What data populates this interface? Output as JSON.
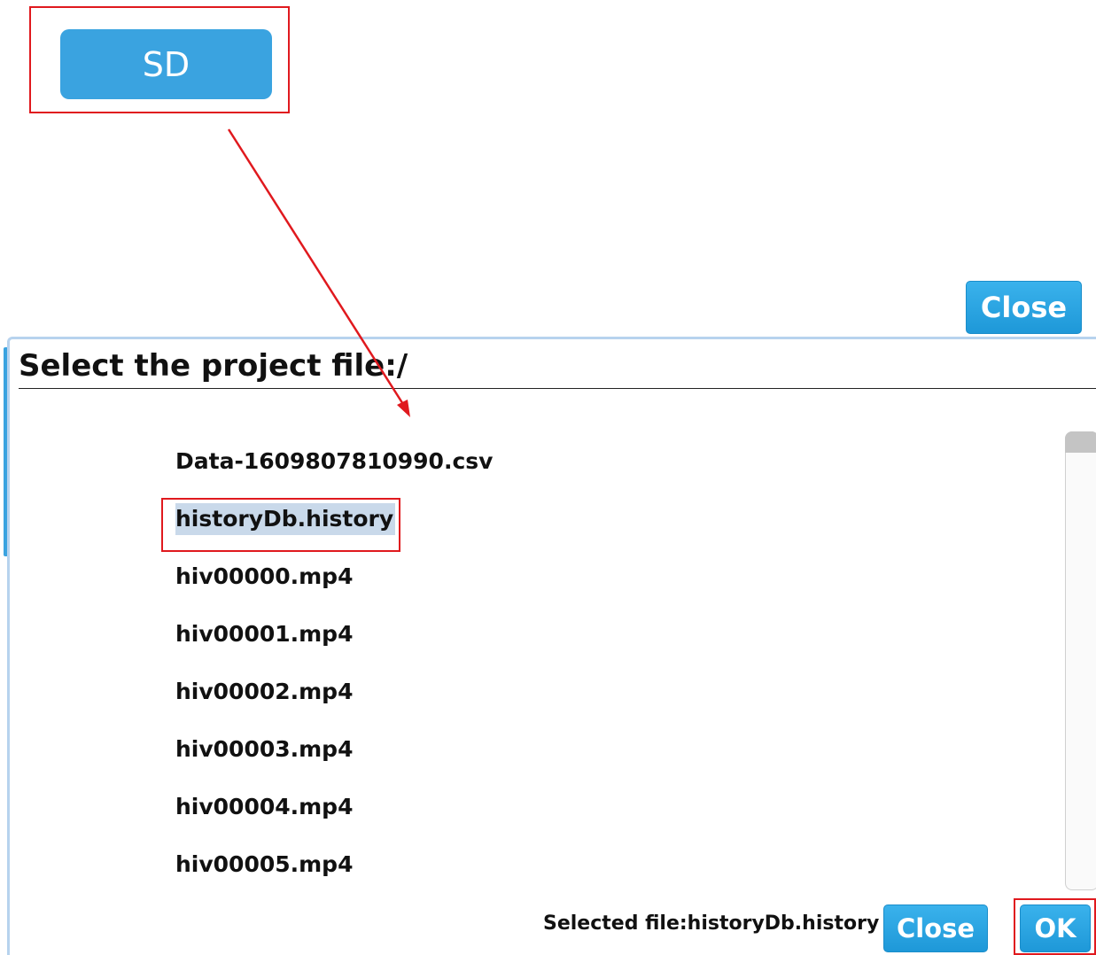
{
  "sd_button": {
    "label": "SD"
  },
  "top_close_button": {
    "label": "Close"
  },
  "dialog": {
    "title": "Select the project file:/",
    "files": [
      "Data-1609807810990.csv",
      "historyDb.history",
      "hiv00000.mp4",
      "hiv00001.mp4",
      "hiv00002.mp4",
      "hiv00003.mp4",
      "hiv00004.mp4",
      "hiv00005.mp4"
    ],
    "selected_index": 1,
    "status_text": "Selected file:historyDb.history",
    "close_label": "Close",
    "ok_label": "OK"
  },
  "colors": {
    "accent_blue": "#3aa3e0",
    "annotation_red": "#e0191e",
    "selection_bg": "#c9d9ea"
  }
}
